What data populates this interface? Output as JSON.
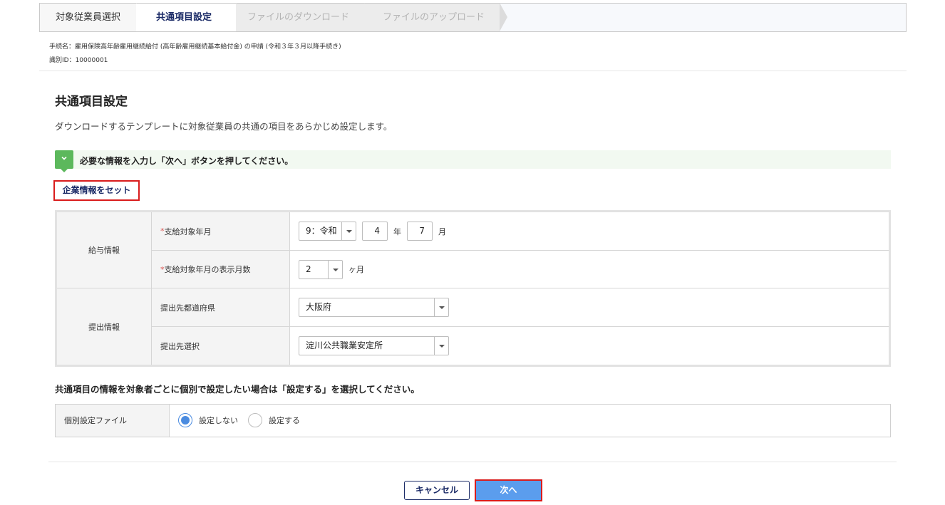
{
  "stepper": {
    "steps": [
      {
        "label": "対象従業員選択",
        "state": "done"
      },
      {
        "label": "共通項目設定",
        "state": "current"
      },
      {
        "label": "ファイルのダウンロード",
        "state": "pending"
      },
      {
        "label": "ファイルのアップロード",
        "state": "pending"
      }
    ]
  },
  "meta": {
    "procedure": "手続名：雇用保険高年齢雇用継続給付 (高年齢雇用継続基本給付金) の申請 (令和３年３月以降手続き)",
    "id": "識別ID：10000001"
  },
  "page": {
    "title": "共通項目設定",
    "description": "ダウンロードするテンプレートに対象従業員の共通の項目をあらかじめ設定します。"
  },
  "notice": {
    "icon": "chevron-down-icon",
    "text": "必要な情報を入力し「次へ」ボタンを押してください。"
  },
  "set_company_button": "企業情報をセット",
  "form": {
    "salary_group": "給与情報",
    "target_month": {
      "required_mark": "*",
      "label": "支給対象年月",
      "era": "9：令和",
      "year": "4",
      "year_unit": "年",
      "month": "7",
      "month_unit": "月"
    },
    "display_months": {
      "required_mark": "*",
      "label": "支給対象年月の表示月数",
      "value": "2",
      "unit": "ヶ月"
    },
    "submission_group": "提出情報",
    "prefecture": {
      "label": "提出先都道府県",
      "value": "大阪府"
    },
    "office": {
      "label": "提出先選択",
      "value": "淀川公共職業安定所"
    }
  },
  "individual": {
    "note": "共通項目の情報を対象者ごとに個別で設定したい場合は「設定する」を選択してください。",
    "label": "個別設定ファイル",
    "option_off": "設定しない",
    "option_on": "設定する",
    "selected": "設定しない"
  },
  "buttons": {
    "cancel": "キャンセル",
    "next": "次へ"
  },
  "colors": {
    "accent": "#5b9ded",
    "navy": "#1a2a66",
    "highlight_border": "#d91c1c",
    "notice_green": "#5cb85c"
  }
}
